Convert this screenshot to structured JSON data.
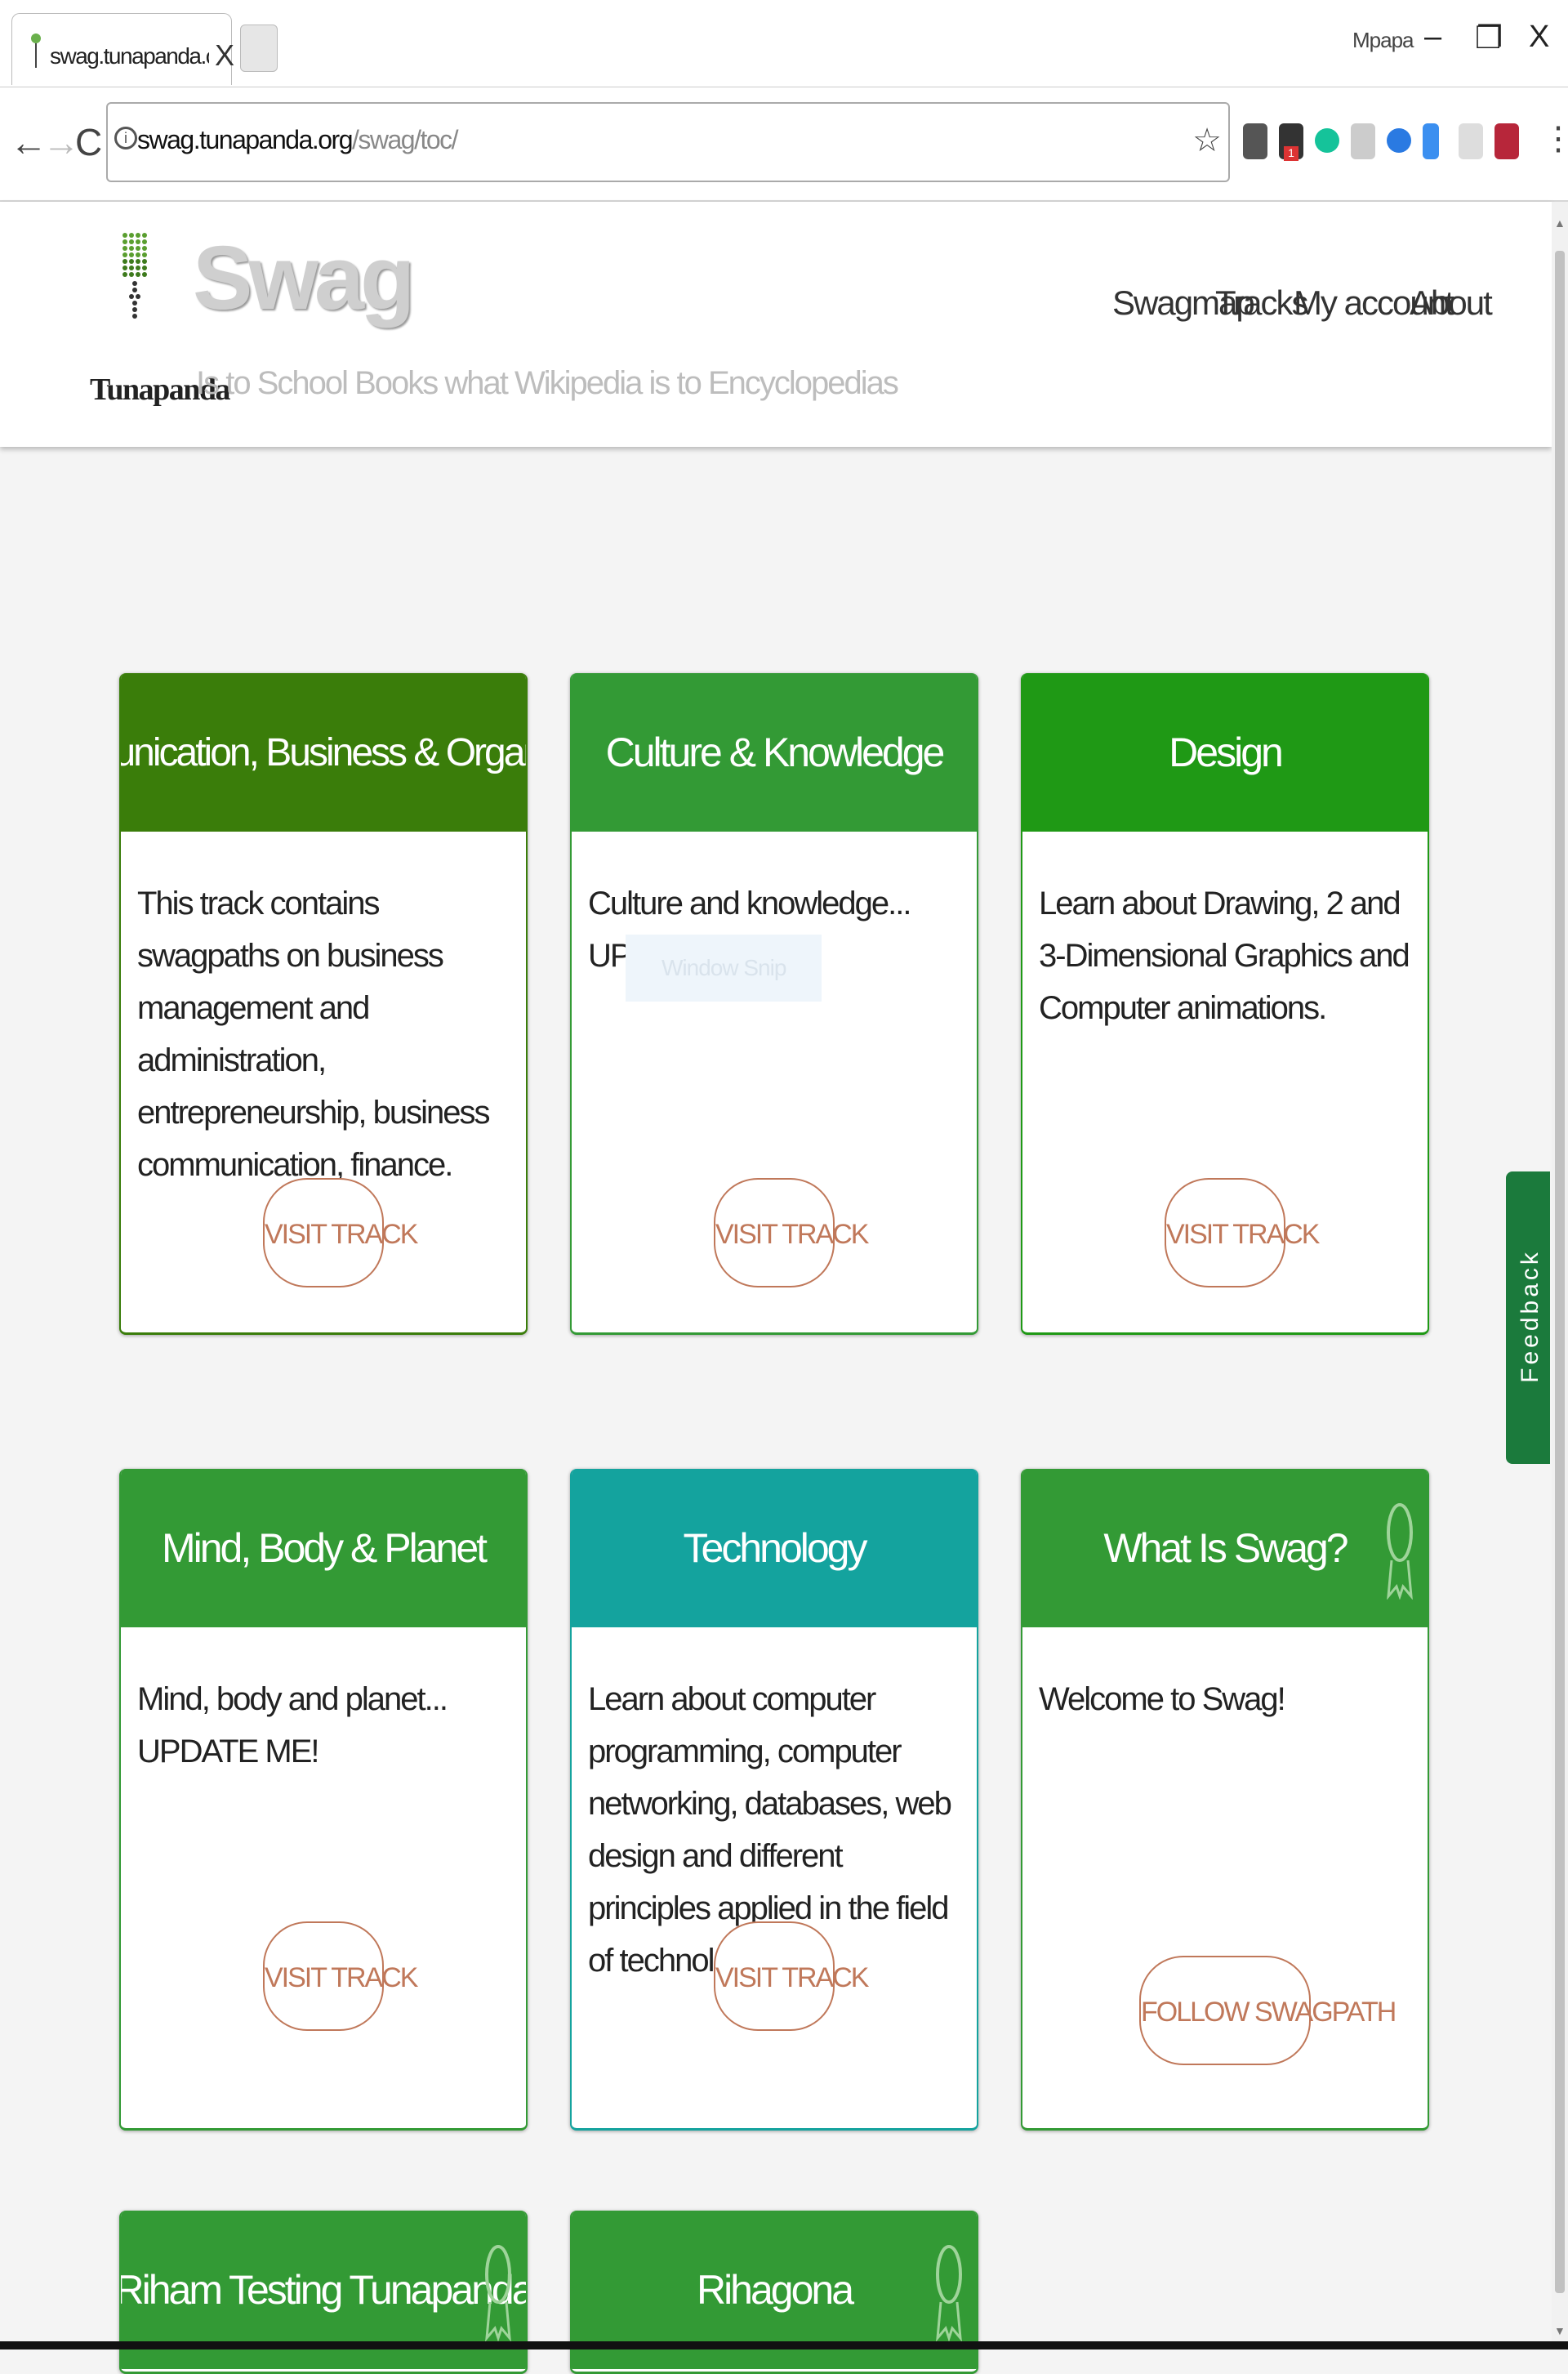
{
  "browser": {
    "tab_title": "swag.tunapanda.org/swa",
    "tab_close": "X",
    "window_user": "Mpapa",
    "url_host": "swag.tunapanda.org",
    "url_path": "/swag/toc/",
    "info_glyph": "i",
    "min_glyph": "–",
    "restore_glyph": "❐",
    "close_glyph": "X",
    "back_glyph": "←",
    "forward_glyph": "→",
    "reload_glyph": "C",
    "star_glyph": "☆",
    "menu_glyph": "⋮"
  },
  "site": {
    "brand": "Swag",
    "logo_text": "Tunapanda",
    "tagline": "Is to School Books what Wikipedia is to Encyclopedias",
    "nav": [
      "Swagmap",
      "Tracks",
      "My account",
      "About"
    ]
  },
  "cards": [
    {
      "title": "Communication, Business & Organization",
      "body": "This track contains swagpaths on business management and administration, entrepreneurship, business communication, finance.",
      "button": "VISIT TRACK",
      "color": "#3a7d0a"
    },
    {
      "title": "Culture & Knowledge",
      "body": "Culture and knowledge... UPDATE ME!!!",
      "button": "VISIT TRACK",
      "color": "#339a35"
    },
    {
      "title": "Design",
      "body": "Learn about Drawing, 2 and 3-Dimensional Graphics and Computer animations.",
      "button": "VISIT TRACK",
      "color": "#1f9915"
    },
    {
      "title": "Mind, Body & Planet",
      "body": "Mind, body and planet... UPDATE ME!",
      "button": "VISIT TRACK",
      "color": "#339a35"
    },
    {
      "title": "Technology",
      "body": "Learn about computer programming, computer networking, databases, web design and different principles applied in the field of technology.",
      "button": "VISIT TRACK",
      "color": "#14a39e"
    },
    {
      "title": "What Is Swag?",
      "body": "Welcome to Swag!",
      "button": "FOLLOW SWAGPATH",
      "color": "#339a35"
    },
    {
      "title": "Riham Testing Tunapanda",
      "body": "",
      "button": "",
      "color": "#339a35"
    },
    {
      "title": "Rihagona",
      "body": "",
      "button": "",
      "color": "#339a35"
    }
  ],
  "overlay": {
    "window_snip": "Window Snip"
  },
  "feedback": "Feedback"
}
